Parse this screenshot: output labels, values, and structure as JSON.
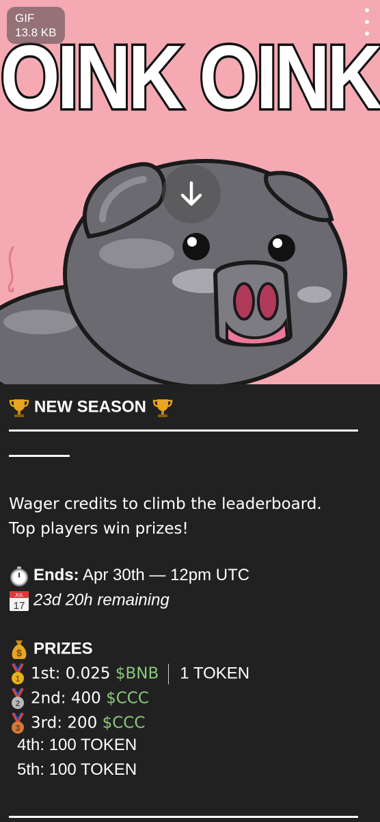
{
  "media": {
    "badge_type": "GIF",
    "badge_size": "13.8 KB",
    "gif_text": "OINK OINK",
    "background_color": "#f4a9b3",
    "download_icon": "arrow-down-icon",
    "menu_icon": "more-vertical-icon"
  },
  "message": {
    "header": "NEW SEASON",
    "intro_line1": "Wager credits to climb the leaderboard.",
    "intro_line2": "Top players win prizes!",
    "ends_label": "Ends:",
    "ends_value": "Apr 30th — 12pm UTC",
    "remaining": "23d 20h remaining",
    "prizes_label": "PRIZES",
    "prizes": {
      "first_prefix": "1st: 0.025 ",
      "first_ticker": "$BNB",
      "first_alt": "1 TOKEN",
      "second_prefix": "2nd: 400 ",
      "second_ticker": "$CCC",
      "third_prefix": "3rd: 200 ",
      "third_ticker": "$CCC",
      "fourth": "4th: 100 TOKEN",
      "fifth": "5th: 100 TOKEN"
    },
    "calendar_label": "JUL",
    "calendar_day": "17",
    "accent_green": "#8bc97b"
  }
}
